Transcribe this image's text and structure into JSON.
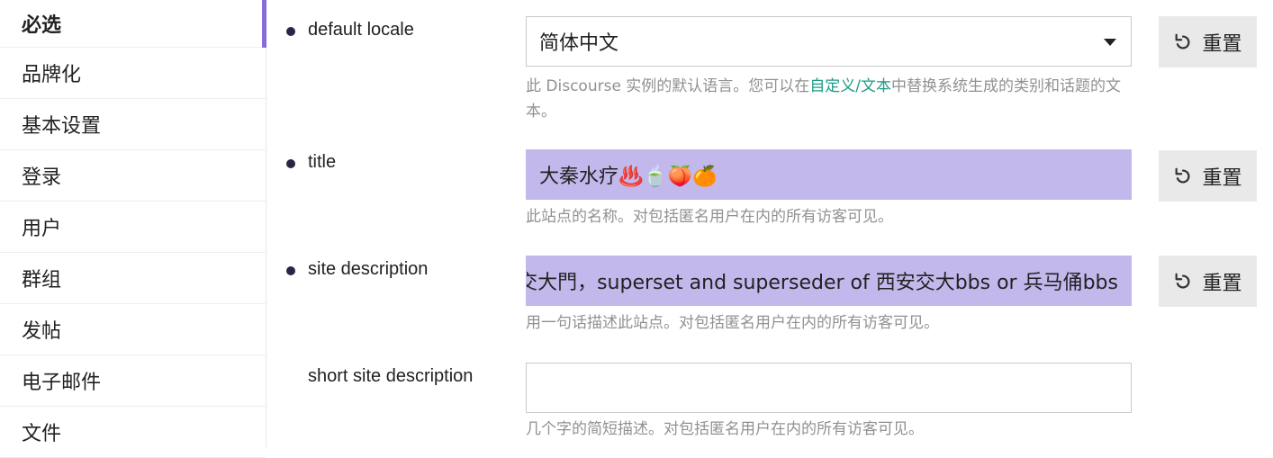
{
  "sidebar": {
    "items": [
      {
        "label": "必选",
        "active": true
      },
      {
        "label": "品牌化"
      },
      {
        "label": "基本设置"
      },
      {
        "label": "登录"
      },
      {
        "label": "用户"
      },
      {
        "label": "群组"
      },
      {
        "label": "发帖"
      },
      {
        "label": "电子邮件"
      },
      {
        "label": "文件"
      }
    ]
  },
  "settings": [
    {
      "label": "default locale",
      "value": "简体中文",
      "desc_before": "此 Discourse 实例的默认语言。您可以在",
      "desc_link": "自定义/文本",
      "desc_after": "中替换系统生成的类别和话题的文本。",
      "reset_label": "重置"
    },
    {
      "label": "title",
      "value": "大秦水疗♨️🍵🍑🍊",
      "desc": "此站点的名称。对包括匿名用户在内的所有访客可见。",
      "reset_label": "重置"
    },
    {
      "label": "site description",
      "value": "交大門，superset and superseder of 西安交大bbs or 兵马俑bbs",
      "desc": "用一句话描述此站点。对包括匿名用户在内的所有访客可见。",
      "reset_label": "重置"
    },
    {
      "label": "short site description",
      "value": "",
      "desc": "几个字的简短描述。对包括匿名用户在内的所有访客可见。"
    }
  ],
  "colors": {
    "accent": "#8a6bdc",
    "changed_field": "#c3b8ec",
    "link": "#1a9b86"
  },
  "icons": {
    "reset": "undo-icon",
    "dropdown": "caret-down-icon",
    "modified": "bullet-dot-icon"
  }
}
